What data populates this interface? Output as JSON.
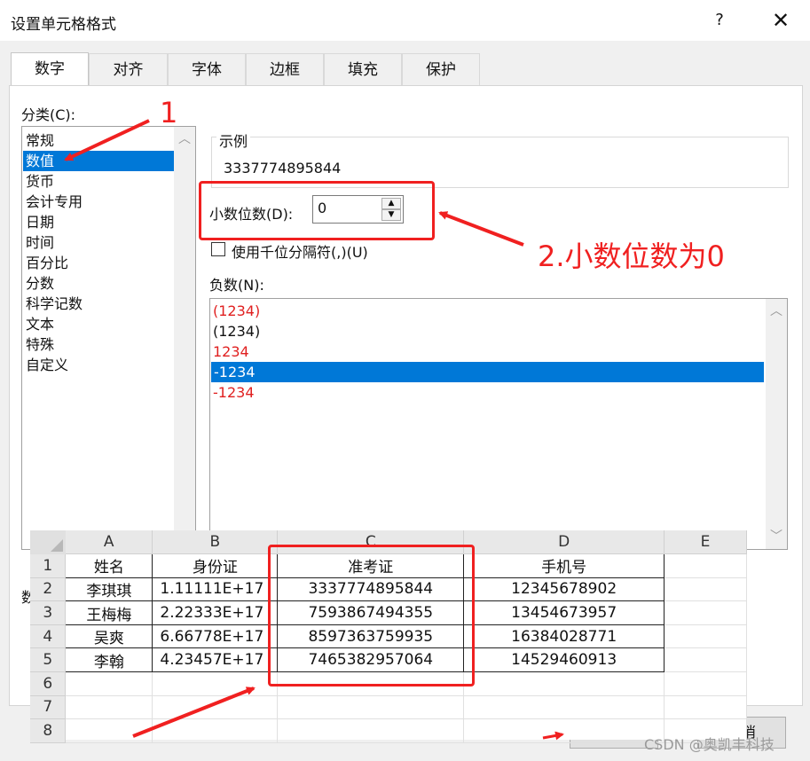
{
  "window": {
    "title": "设置单元格格式",
    "help_icon": "?",
    "close_icon": "✕"
  },
  "tabs": [
    {
      "label": "数字",
      "active": true
    },
    {
      "label": "对齐"
    },
    {
      "label": "字体"
    },
    {
      "label": "边框"
    },
    {
      "label": "填充"
    },
    {
      "label": "保护"
    }
  ],
  "category": {
    "label": "分类(C):",
    "items": [
      "常规",
      "数值",
      "货币",
      "会计专用",
      "日期",
      "时间",
      "百分比",
      "分数",
      "科学记数",
      "文本",
      "特殊",
      "自定义"
    ],
    "selected": "数值"
  },
  "sample": {
    "label": "示例",
    "value": "3337774895844"
  },
  "decimal": {
    "label": "小数位数(D):",
    "value": "0"
  },
  "thousands": {
    "label": "使用千位分隔符(,)(U)",
    "checked": false
  },
  "negative": {
    "label": "负数(N):",
    "items": [
      {
        "text": "(1234)",
        "color": "#e02020"
      },
      {
        "text": "(1234)",
        "color": "#111111"
      },
      {
        "text": "1234",
        "color": "#e02020"
      },
      {
        "text": "-1234",
        "color": "#ffffff",
        "selected": true
      },
      {
        "text": "-1234",
        "color": "#e02020"
      }
    ]
  },
  "annotations": {
    "step1": "1",
    "step2": "2.小数位数为0"
  },
  "hidden_text": "数",
  "ok_button": "确定",
  "cancel_button": "取消",
  "sheet": {
    "columns": [
      "A",
      "B",
      "C",
      "D",
      "E"
    ],
    "rows": [
      {
        "n": "1",
        "cells": [
          "姓名",
          "身份证",
          "准考证",
          "手机号",
          ""
        ]
      },
      {
        "n": "2",
        "cells": [
          "李琪琪",
          "1.11111E+17",
          "3337774895844",
          "12345678902",
          ""
        ]
      },
      {
        "n": "3",
        "cells": [
          "王梅梅",
          "2.22333E+17",
          "7593867494355",
          "13454673957",
          ""
        ]
      },
      {
        "n": "4",
        "cells": [
          "吴爽",
          "6.66778E+17",
          "8597363759935",
          "16384028771",
          ""
        ]
      },
      {
        "n": "5",
        "cells": [
          "李翰",
          "4.23457E+17",
          "7465382957064",
          "14529460913",
          ""
        ]
      },
      {
        "n": "6",
        "cells": [
          "",
          "",
          "",
          "",
          ""
        ]
      },
      {
        "n": "7",
        "cells": [
          "",
          "",
          "",
          "",
          ""
        ]
      },
      {
        "n": "8",
        "cells": [
          "",
          "",
          "",
          "",
          ""
        ]
      }
    ]
  },
  "watermark": "CSDN @奥凯丰科技",
  "colors": {
    "accent": "#0078d7",
    "annotation": "#f02020"
  }
}
